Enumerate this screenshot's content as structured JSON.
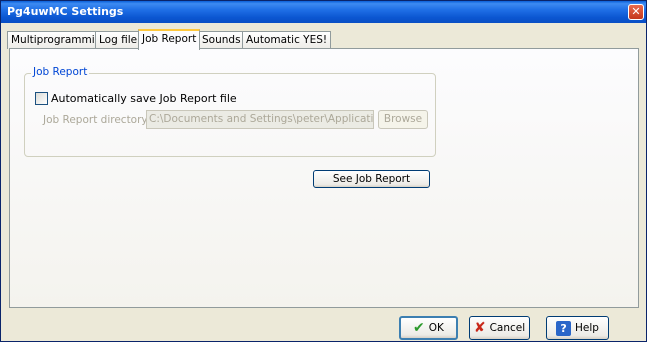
{
  "window": {
    "title": "Pg4uwMC Settings"
  },
  "tabs": [
    {
      "label": "Multiprogramming"
    },
    {
      "label": "Log file"
    },
    {
      "label": "Job Report"
    },
    {
      "label": "Sounds"
    },
    {
      "label": "Automatic YES!"
    }
  ],
  "active_tab": "Job Report",
  "job_report": {
    "group_title": "Job Report",
    "auto_save_label": "Automatically save Job Report file",
    "auto_save_checked": false,
    "directory_label": "Job Report directory:",
    "directory_value": "C:\\Documents and Settings\\peter\\Application Data",
    "browse_label": "Browse",
    "see_report_label": "See Job Report"
  },
  "footer": {
    "ok_label": "OK",
    "cancel_label": "Cancel",
    "help_label": "Help"
  },
  "icons": {
    "close": "close-icon",
    "ok": "check-icon",
    "cancel": "x-icon",
    "help": "help-icon"
  },
  "colors": {
    "titlebar": "#0a5fd8",
    "group_title": "#0046d5",
    "active_tab_highlight": "#ffc83c",
    "disabled_text": "#aca899"
  }
}
